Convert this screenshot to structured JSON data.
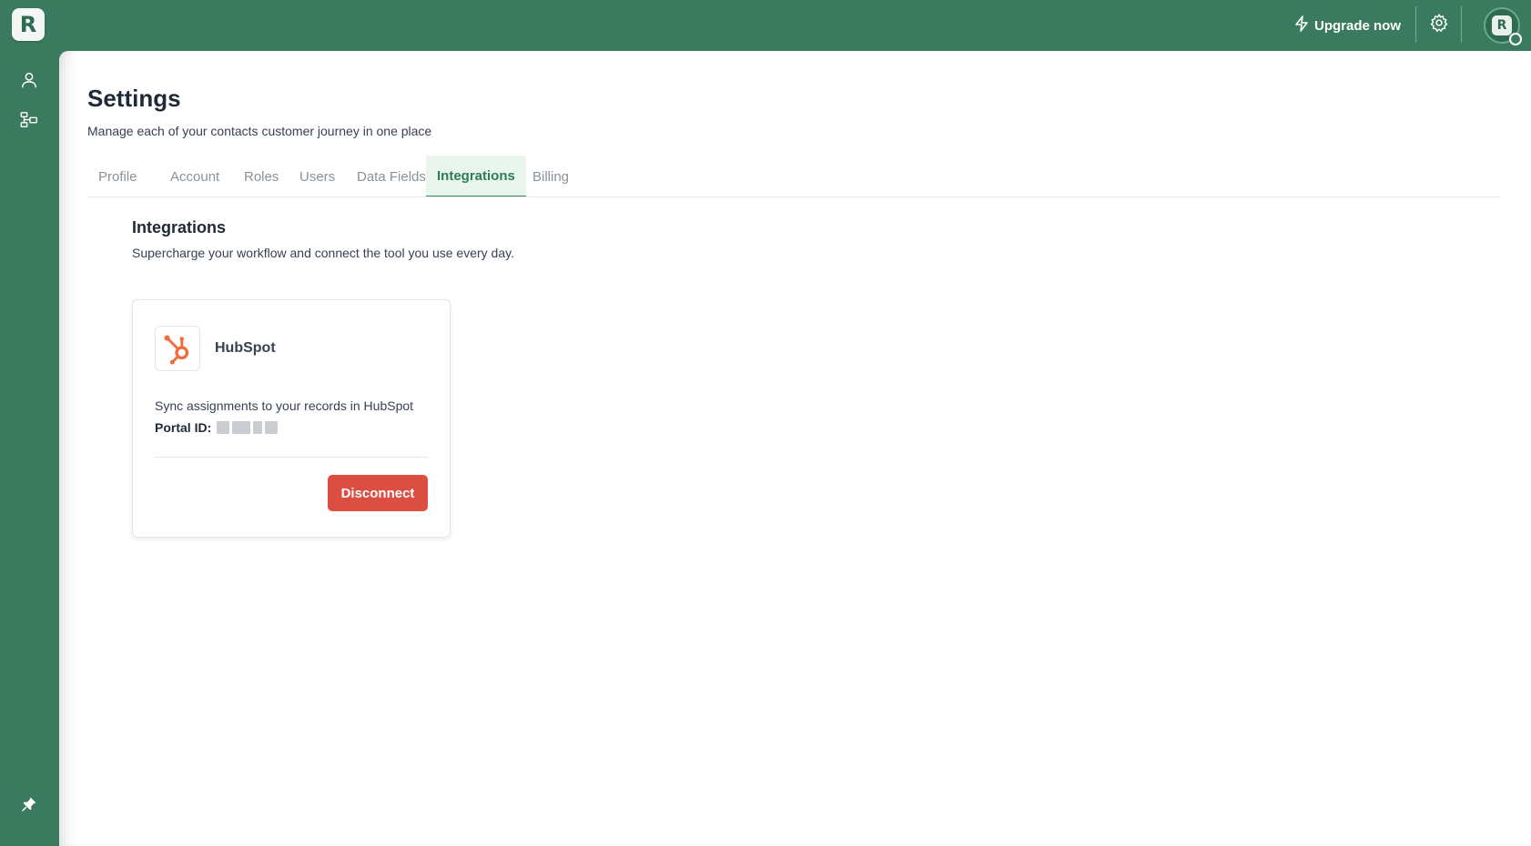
{
  "app": {
    "logo_letter": "R",
    "brand_color": "#3a7a5f"
  },
  "topbar": {
    "upgrade_label": "Upgrade now",
    "avatar_letter": "R"
  },
  "sidebar": {
    "items": [
      {
        "icon": "user-icon"
      },
      {
        "icon": "org-chart-icon"
      }
    ],
    "footer_icon": "pin-icon"
  },
  "page": {
    "title": "Settings",
    "subtitle": "Manage each of your contacts customer journey in one place"
  },
  "tabs": [
    {
      "label": "Profile",
      "active": false
    },
    {
      "label": "Account",
      "active": false
    },
    {
      "label": "Roles",
      "active": false
    },
    {
      "label": "Users",
      "active": false
    },
    {
      "label": "Data Fields",
      "active": false
    },
    {
      "label": "Integrations",
      "active": true
    },
    {
      "label": "Billing",
      "active": false
    }
  ],
  "section": {
    "title": "Integrations",
    "subtitle": "Supercharge your workflow and connect the tool you use every day."
  },
  "integration": {
    "name": "HubSpot",
    "description": "Sync assignments to your records in HubSpot",
    "portal_label": "Portal ID:",
    "disconnect_label": "Disconnect",
    "accent_color": "#f26a3d",
    "button_color": "#dd4e42"
  }
}
